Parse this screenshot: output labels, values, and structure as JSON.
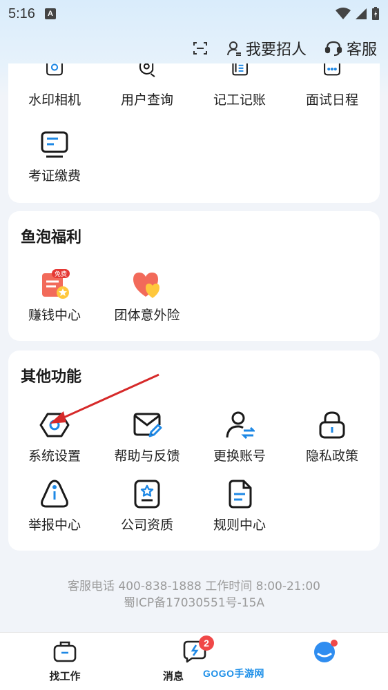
{
  "status_bar": {
    "time": "5:16",
    "sim_label": "A"
  },
  "header_actions": {
    "recruit_label": "我要招人",
    "service_label": "客服"
  },
  "tools_section": {
    "items": [
      {
        "label": "水印相机",
        "icon": "camera-icon"
      },
      {
        "label": "用户查询",
        "icon": "user-search-icon"
      },
      {
        "label": "记工记账",
        "icon": "ledger-icon"
      },
      {
        "label": "面试日程",
        "icon": "calendar-icon"
      },
      {
        "label": "考证缴费",
        "icon": "monitor-icon"
      }
    ]
  },
  "benefits_section": {
    "title": "鱼泡福利",
    "items": [
      {
        "label": "赚钱中心",
        "icon": "earn-coupon-icon",
        "tag": "免费"
      },
      {
        "label": "团体意外险",
        "icon": "heart-insurance-icon"
      }
    ]
  },
  "other_section": {
    "title": "其他功能",
    "items": [
      {
        "label": "系统设置",
        "icon": "settings-icon"
      },
      {
        "label": "帮助与反馈",
        "icon": "mail-feedback-icon"
      },
      {
        "label": "更换账号",
        "icon": "switch-account-icon"
      },
      {
        "label": "隐私政策",
        "icon": "lock-icon"
      },
      {
        "label": "举报中心",
        "icon": "report-icon"
      },
      {
        "label": "公司资质",
        "icon": "certificate-icon"
      },
      {
        "label": "规则中心",
        "icon": "rules-document-icon"
      }
    ]
  },
  "footer": {
    "line1": "客服电话 400-838-1888 工作时间 8:00-21:00",
    "line2": "蜀ICP备17030551号-15A"
  },
  "tab_bar": {
    "tabs": [
      {
        "label": "找工作",
        "icon": "briefcase-icon"
      },
      {
        "label": "消息",
        "icon": "message-icon",
        "badge": "2"
      },
      {
        "label": "",
        "icon": "profile-avatar-icon"
      }
    ]
  },
  "watermark": "GOGO手游网",
  "colors": {
    "accent": "#1e88e5",
    "red": "#e53935",
    "badge": "#f04848"
  }
}
